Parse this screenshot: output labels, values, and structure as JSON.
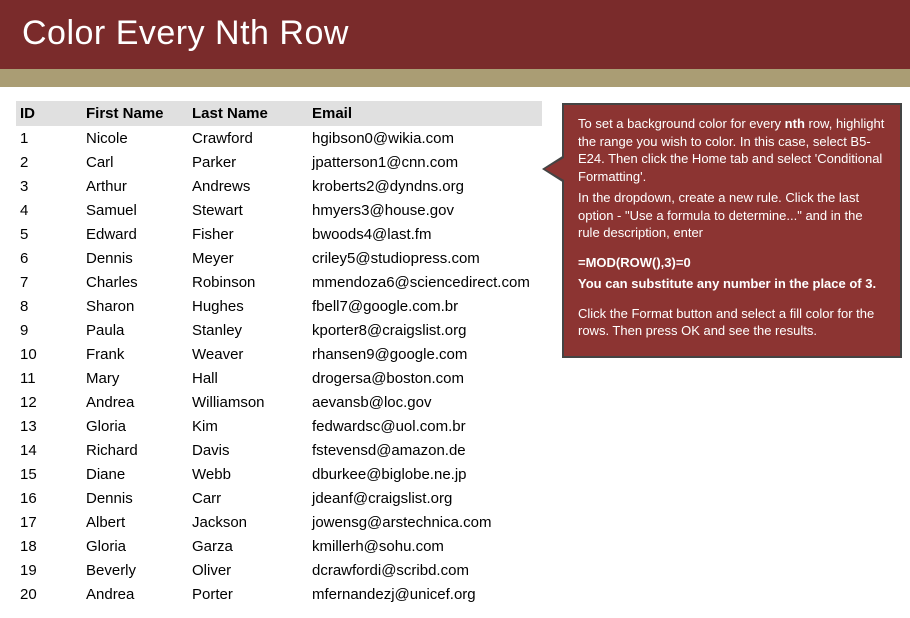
{
  "header": {
    "title": "Color Every Nth Row"
  },
  "table": {
    "headers": [
      "ID",
      "First Name",
      "Last Name",
      "Email"
    ],
    "rows": [
      {
        "id": "1",
        "first": "Nicole",
        "last": "Crawford",
        "email": "hgibson0@wikia.com"
      },
      {
        "id": "2",
        "first": "Carl",
        "last": "Parker",
        "email": "jpatterson1@cnn.com"
      },
      {
        "id": "3",
        "first": "Arthur",
        "last": "Andrews",
        "email": "kroberts2@dyndns.org"
      },
      {
        "id": "4",
        "first": "Samuel",
        "last": "Stewart",
        "email": "hmyers3@house.gov"
      },
      {
        "id": "5",
        "first": "Edward",
        "last": "Fisher",
        "email": "bwoods4@last.fm"
      },
      {
        "id": "6",
        "first": "Dennis",
        "last": "Meyer",
        "email": "criley5@studiopress.com"
      },
      {
        "id": "7",
        "first": "Charles",
        "last": "Robinson",
        "email": "mmendoza6@sciencedirect.com"
      },
      {
        "id": "8",
        "first": "Sharon",
        "last": "Hughes",
        "email": "fbell7@google.com.br"
      },
      {
        "id": "9",
        "first": "Paula",
        "last": "Stanley",
        "email": "kporter8@craigslist.org"
      },
      {
        "id": "10",
        "first": "Frank",
        "last": "Weaver",
        "email": "rhansen9@google.com"
      },
      {
        "id": "11",
        "first": "Mary",
        "last": "Hall",
        "email": "drogersa@boston.com"
      },
      {
        "id": "12",
        "first": "Andrea",
        "last": "Williamson",
        "email": "aevansb@loc.gov"
      },
      {
        "id": "13",
        "first": "Gloria",
        "last": "Kim",
        "email": "fedwardsc@uol.com.br"
      },
      {
        "id": "14",
        "first": "Richard",
        "last": "Davis",
        "email": "fstevensd@amazon.de"
      },
      {
        "id": "15",
        "first": "Diane",
        "last": "Webb",
        "email": "dburkee@biglobe.ne.jp"
      },
      {
        "id": "16",
        "first": "Dennis",
        "last": "Carr",
        "email": "jdeanf@craigslist.org"
      },
      {
        "id": "17",
        "first": "Albert",
        "last": "Jackson",
        "email": "jowensg@arstechnica.com"
      },
      {
        "id": "18",
        "first": "Gloria",
        "last": "Garza",
        "email": "kmillerh@sohu.com"
      },
      {
        "id": "19",
        "first": "Beverly",
        "last": "Oliver",
        "email": "dcrawfordi@scribd.com"
      },
      {
        "id": "20",
        "first": "Andrea",
        "last": "Porter",
        "email": "mfernandezj@unicef.org"
      }
    ]
  },
  "callout": {
    "line1a": "To set a background color for every ",
    "line1b": "nth",
    "line1c": " row, highlight the range you wish to color. In this case, select B5-E24. Then click the Home tab and select 'Conditional Formatting'.",
    "line2": "In the dropdown, create a new rule. Click the last option - \"Use a formula to determine...\" and in the rule description, enter",
    "formula": "=MOD(ROW(),3)=0",
    "subnote": "You can substitute any number in the place of 3.",
    "line3": "Click the Format button and select a fill color for the rows. Then press OK and see the results."
  }
}
